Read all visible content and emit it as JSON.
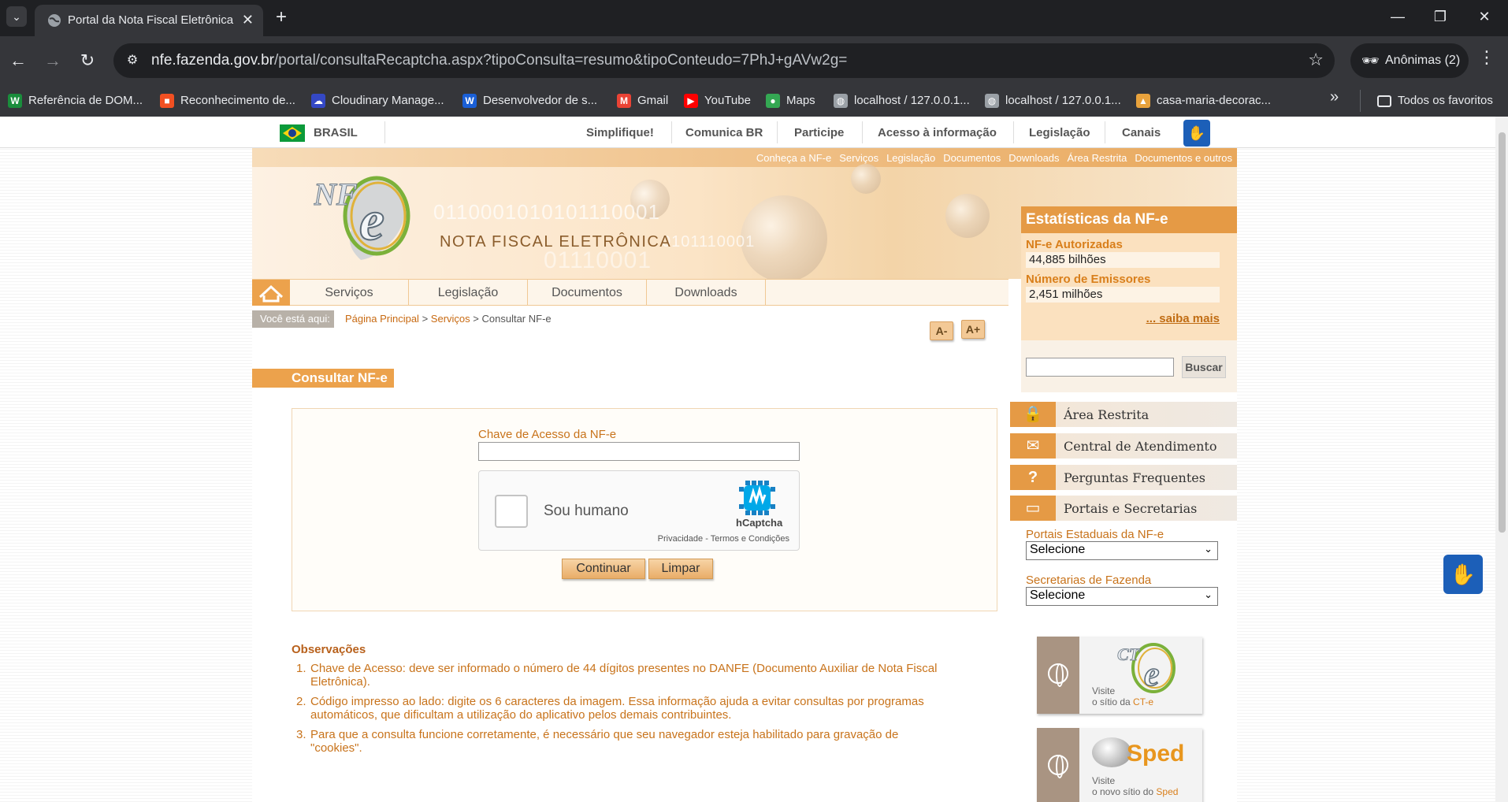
{
  "browser": {
    "tab_title": "Portal da Nota Fiscal Eletrônica",
    "url_host": "nfe.fazenda.gov.br",
    "url_path": "/portal/consultaRecaptcha.aspx?tipoConsulta=resumo&tipoConteudo=7PhJ+gAVw2g=",
    "profile": "Anônimas (2)",
    "bookmarks": [
      {
        "label": "Referência de DOM...",
        "icon": "w-icon",
        "color": "#1a8d3c"
      },
      {
        "label": "Reconhecimento de...",
        "icon": "microsoft-icon",
        "color": "#f25022"
      },
      {
        "label": "Cloudinary Manage...",
        "icon": "cloudinary-icon",
        "color": "#3448c5"
      },
      {
        "label": "Desenvolvedor de s...",
        "icon": "w-blue-icon",
        "color": "#1a5fd6"
      },
      {
        "label": "Gmail",
        "icon": "gmail-icon",
        "color": "#ea4335"
      },
      {
        "label": "YouTube",
        "icon": "youtube-icon",
        "color": "#ff0000"
      },
      {
        "label": "Maps",
        "icon": "maps-icon",
        "color": "#34a853"
      },
      {
        "label": "localhost / 127.0.0.1...",
        "icon": "globe-icon",
        "color": "#9aa0a6"
      },
      {
        "label": "localhost / 127.0.0.1...",
        "icon": "globe-icon",
        "color": "#9aa0a6"
      },
      {
        "label": "casa-maria-decorac...",
        "icon": "triangle-icon",
        "color": "#e8a23c"
      }
    ],
    "all_bookmarks": "Todos os favoritos"
  },
  "govbar": {
    "country": "BRASIL",
    "links": [
      "Simplifique!",
      "Comunica BR",
      "Participe",
      "Acesso à informação",
      "Legislação",
      "Canais"
    ]
  },
  "header": {
    "toplinks": [
      "Conheça a NF-e",
      "Serviços",
      "Legislação",
      "Documentos",
      "Downloads",
      "Área Restrita",
      "Documentos e outros"
    ],
    "logo_text": "NF",
    "logo_letter": "e",
    "site_title": "NOTA FISCAL ELETRÔNICA",
    "binary_1": "0110001010101110001",
    "binary_2": "0101110001",
    "binary_3": "01110001"
  },
  "stats": {
    "title": "Estatísticas da NF-e",
    "authorized_label": "NF-e Autorizadas",
    "authorized_value": "44,885 bilhões",
    "emitters_label": "Número de Emissores",
    "emitters_value": "2,451 milhões",
    "more": "... saiba mais"
  },
  "nav": {
    "items": [
      "Serviços",
      "Legislação",
      "Documentos",
      "Downloads"
    ]
  },
  "breadcrumb": {
    "label": "Você está aqui:",
    "home": "Página Principal",
    "sep": ">",
    "services": "Serviços",
    "current": "Consultar NF-e"
  },
  "font_controls": {
    "decrease": "A-",
    "increase": "A+"
  },
  "main": {
    "section_title": "Consultar NF-e",
    "field_label": "Chave de Acesso da NF-e",
    "field_value": "",
    "captcha_text": "Sou humano",
    "captcha_brand": "hCaptcha",
    "captcha_links": "Privacidade - Termos e Condições",
    "continue": "Continuar",
    "clear": "Limpar"
  },
  "observations": {
    "title": "Observações",
    "items": [
      "Chave de Acesso: deve ser informado o número de 44 dígitos presentes no DANFE (Documento Auxiliar de Nota Fiscal Eletrônica).",
      "Código impresso ao lado: digite os 6 caracteres da imagem. Essa informação ajuda a evitar consultas por programas automáticos, que dificultam a utilização do aplicativo pelos demais contribuintes.",
      "Para que a consulta funcione corretamente, é necessário que seu navegador esteja habilitado para gravação de \"cookies\"."
    ]
  },
  "sidebar": {
    "search_button": "Buscar",
    "search_value": "",
    "links": [
      "Área Restrita",
      "Central de Atendimento",
      "Perguntas Frequentes",
      "Portais e Secretarias"
    ],
    "portals_label": "Portais Estaduais da NF-e",
    "portals_selected": "Selecione",
    "secretarias_label": "Secretarias de Fazenda",
    "secretarias_selected": "Selecione",
    "cte_visit": "Visite",
    "cte_site": "o sítio da ",
    "cte_name": "CT-e",
    "cte_logo": "CT-e",
    "sped_visit": "Visite",
    "sped_site": "o novo sítio do ",
    "sped_name": "Sped",
    "sped_logo": "Sped"
  },
  "colors": {
    "accent": "#e59a45",
    "link": "#c86a12",
    "vlibras": "#1c5fb8"
  }
}
